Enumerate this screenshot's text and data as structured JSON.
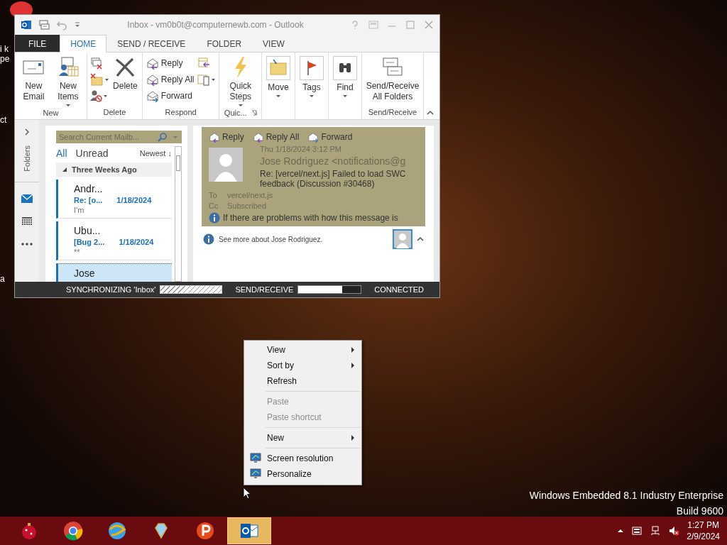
{
  "desktop": {
    "icon_labels": [
      "i k",
      "pe",
      "ct",
      "a"
    ],
    "edition": "Windows Embedded 8.1 Industry Enterprise",
    "build": "Build 9600"
  },
  "outlook": {
    "title": "Inbox - vm0b0t@computernewb.com - Outlook",
    "tabs": [
      {
        "label": "FILE",
        "kind": "backstage",
        "selected": false
      },
      {
        "label": "HOME",
        "kind": "tab",
        "selected": true
      },
      {
        "label": "SEND / RECEIVE",
        "kind": "tab",
        "selected": false
      },
      {
        "label": "FOLDER",
        "kind": "tab",
        "selected": false
      },
      {
        "label": "VIEW",
        "kind": "tab",
        "selected": false
      }
    ],
    "ribbon": [
      {
        "name": "New",
        "kind": "plain",
        "buttons": [
          {
            "label": "New Email",
            "dropdown": false
          },
          {
            "label": "New Items",
            "dropdown": true
          }
        ]
      },
      {
        "name": "Delete",
        "kind": "delete",
        "buttons": [
          {
            "label": "Delete",
            "dropdown": false
          }
        ]
      },
      {
        "name": "Respond",
        "kind": "respond",
        "small_buttons": [
          "Reply",
          "Reply All",
          "Forward"
        ]
      },
      {
        "name": "Quic...",
        "kind": "launcher",
        "buttons": [
          {
            "label": "Quick Steps",
            "dropdown": true
          }
        ]
      },
      {
        "kind": "plain",
        "buttons": [
          {
            "label": "Move",
            "dropdown": true
          }
        ]
      },
      {
        "kind": "plain",
        "buttons": [
          {
            "label": "Tags",
            "dropdown": true
          }
        ]
      },
      {
        "kind": "plain",
        "buttons": [
          {
            "label": "Find",
            "dropdown": true
          }
        ]
      },
      {
        "name": "Send/Receive",
        "kind": "plain",
        "buttons": [
          {
            "label": "Send/Receive All Folders",
            "dropdown": false
          }
        ]
      }
    ],
    "nav": {
      "folders_label": "Folders"
    },
    "list": {
      "search_placeholder": "Search Current Mailb...",
      "filters": [
        {
          "label": "All",
          "selected": true
        },
        {
          "label": "Unread",
          "selected": false
        }
      ],
      "sort": "Newest ↓",
      "group": "Three Weeks Ago",
      "messages": [
        {
          "sender": "Andr...",
          "subject": "Re: [o...",
          "date": "1/18/2024",
          "preview": "I'm",
          "selected": false
        },
        {
          "sender": "Ubu...",
          "subject": "[Bug 2...",
          "date": "1/18/2024",
          "preview": "**",
          "selected": false
        },
        {
          "sender": "Jose",
          "selected": true
        }
      ]
    },
    "reading": {
      "actions": [
        "Reply",
        "Reply All",
        "Forward"
      ],
      "date": "Thu 1/18/2024 3:12 PM",
      "from": "Jose Rodriguez <notifications@g",
      "subject": "Re: [vercel/next.js] Failed to load SWC feedback (Discussion #30468)",
      "to_label": "To",
      "to": "vercel/next.js",
      "cc_label": "Cc",
      "cc": "Subscribed",
      "notice": "If there are problems with how this message is",
      "people": "See more about Jose Rodriguez."
    },
    "status": {
      "sync": "SYNCHRONIZING  'Inbox'",
      "send_receive": "SEND/RECEIVE",
      "level": 0.7,
      "connection": "CONNECTED"
    }
  },
  "context_menu": [
    {
      "kind": "item",
      "label": "View",
      "submenu": true,
      "disabled": false
    },
    {
      "kind": "item",
      "label": "Sort by",
      "submenu": true,
      "disabled": false
    },
    {
      "kind": "item",
      "label": "Refresh",
      "submenu": false,
      "disabled": false
    },
    {
      "kind": "separator"
    },
    {
      "kind": "item",
      "label": "Paste",
      "submenu": false,
      "disabled": true
    },
    {
      "kind": "item",
      "label": "Paste shortcut",
      "submenu": false,
      "disabled": true
    },
    {
      "kind": "separator"
    },
    {
      "kind": "item",
      "label": "New",
      "submenu": true,
      "disabled": false
    },
    {
      "kind": "separator"
    },
    {
      "kind": "icon-item",
      "label": "Screen resolution",
      "submenu": false,
      "disabled": false
    },
    {
      "kind": "icon-item",
      "label": "Personalize",
      "submenu": false,
      "disabled": false
    }
  ],
  "taskbar": {
    "apps": [
      {
        "selected": false
      },
      {
        "selected": false
      },
      {
        "selected": false
      },
      {
        "selected": false
      },
      {
        "selected": false
      },
      {
        "selected": true
      }
    ],
    "time": "1:27 PM",
    "date": "2/9/2024"
  }
}
